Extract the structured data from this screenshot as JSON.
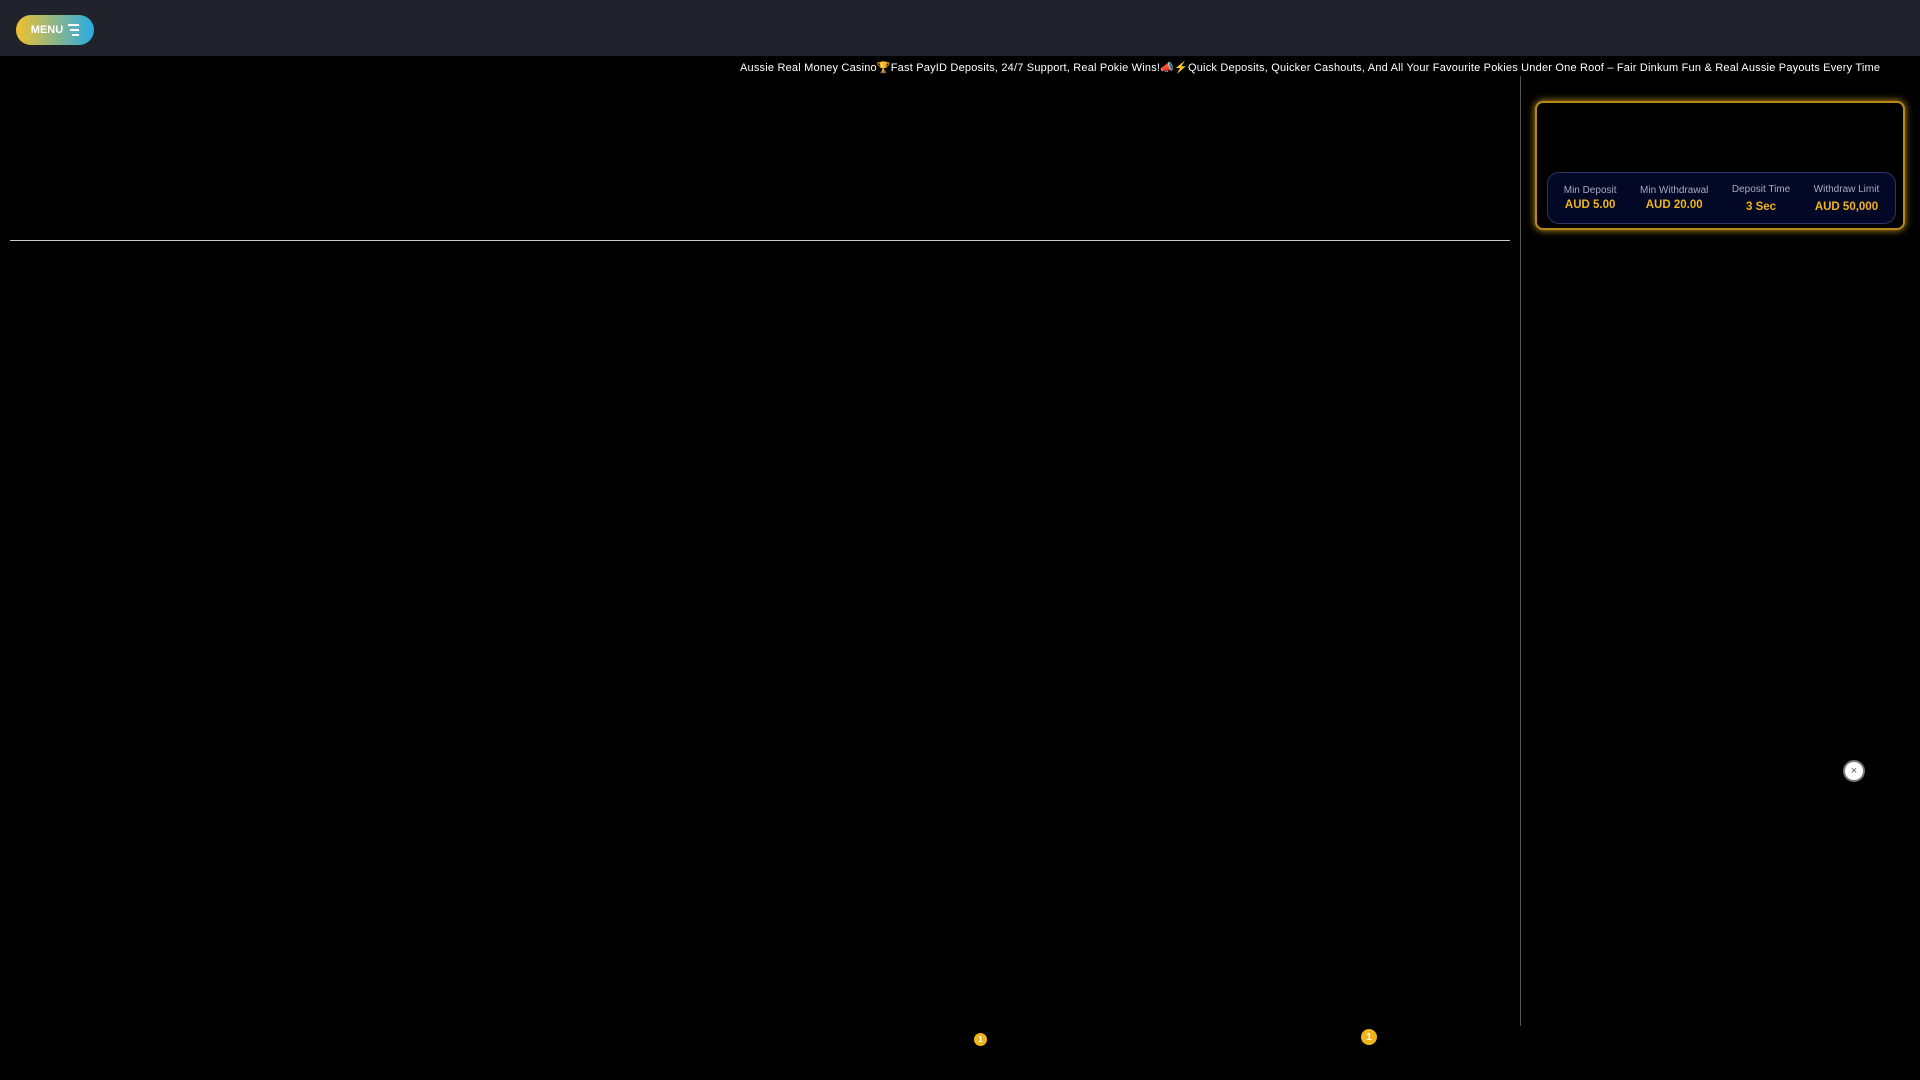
{
  "header": {
    "menu_label": "MENU"
  },
  "ticker": {
    "text": "Aussie Real Money Casino🏆Fast PayID Deposits, 24/7 Support, Real Pokie Wins!📣⚡Quick Deposits, Quicker Cashouts, And All Your Favourite Pokies Under One Roof – Fair Dinkum Fun & Real Aussie Payouts Every Time"
  },
  "stats": [
    {
      "label": "Min Deposit",
      "value": "AUD 5.00"
    },
    {
      "label": "Min Withdrawal",
      "value": "AUD 20.00"
    },
    {
      "label": "Deposit Time",
      "value": "3 Sec"
    },
    {
      "label": "Withdraw Limit",
      "value": "AUD 50,000"
    }
  ],
  "close_symbol": "×",
  "badges": [
    "1",
    "1"
  ],
  "colors": {
    "accent": "#f1b51c",
    "header": "#20232c"
  }
}
